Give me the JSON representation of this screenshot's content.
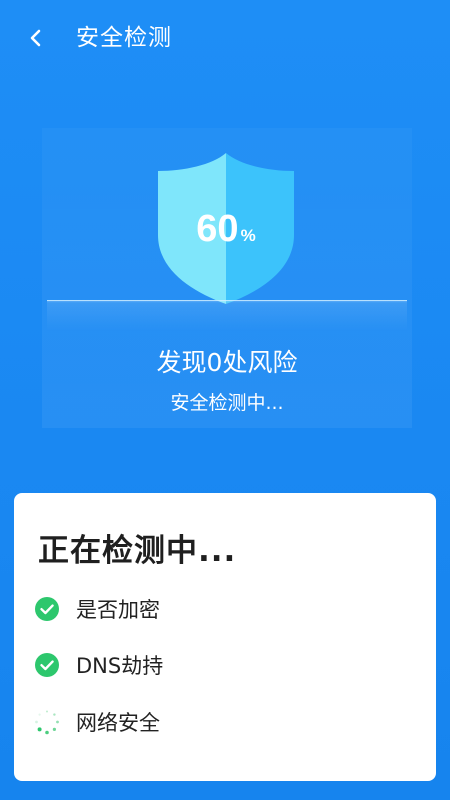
{
  "header": {
    "title": "安全检测",
    "back_icon": "chevron-left-icon"
  },
  "scan": {
    "progress": 60,
    "progress_unit": "%",
    "risk_text": "发现0处风险",
    "status_text": "安全检测中..."
  },
  "card": {
    "title": "正在检测中...",
    "items": [
      {
        "label": "是否加密",
        "state": "done",
        "icon": "check-circle-icon"
      },
      {
        "label": "DNS劫持",
        "state": "done",
        "icon": "check-circle-icon"
      },
      {
        "label": "网络安全",
        "state": "loading",
        "icon": "loading-spinner-icon"
      }
    ]
  },
  "colors": {
    "background": "#1a8cf5",
    "shield_left": "#7fe6fb",
    "shield_right": "#3cc3fb",
    "success": "#2dc76d",
    "card": "#ffffff"
  }
}
